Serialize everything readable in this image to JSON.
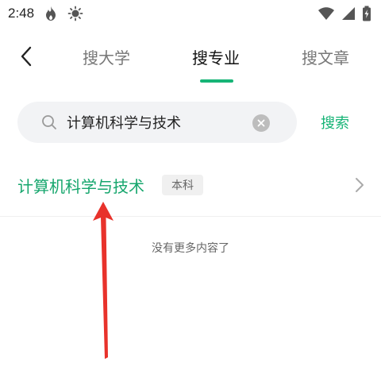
{
  "status_bar": {
    "time": "2:48",
    "icons": [
      "fire-icon",
      "brightness-icon",
      "wifi-icon",
      "signal-icon",
      "battery-icon"
    ]
  },
  "header": {
    "tabs": [
      {
        "label": "搜大学",
        "active": false
      },
      {
        "label": "搜专业",
        "active": true
      },
      {
        "label": "搜文章",
        "active": false
      }
    ]
  },
  "search": {
    "value": "计算机科学与技术",
    "button_label": "搜索"
  },
  "results": [
    {
      "title": "计算机科学与技术",
      "tag": "本科"
    }
  ],
  "footer": {
    "no_more_text": "没有更多内容了"
  },
  "colors": {
    "accent": "#16b476",
    "result_title": "#16a66d",
    "annotation_arrow": "#e8322b"
  }
}
